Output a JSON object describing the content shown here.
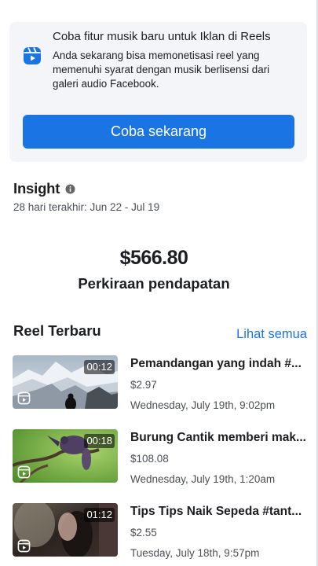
{
  "promo": {
    "title": "Coba fitur musik baru untuk Iklan di Reels",
    "description": "Anda sekarang bisa memonetisasi reel yang memenuhi syarat dengan musik berlisensi dari galeri audio Facebook.",
    "button_label": "Coba sekarang",
    "icon": "reels-icon"
  },
  "insight": {
    "title": "Insight",
    "range": "28 hari terakhir: Jun 22 - Jul 19",
    "icon": "info-icon"
  },
  "earnings": {
    "value": "$566.80",
    "label": "Perkiraan pendapatan"
  },
  "reels": {
    "title": "Reel Terbaru",
    "see_all": "Lihat semua",
    "items": [
      {
        "duration": "00:12",
        "title": "Pemandangan yang indah #...",
        "amount": "$2.97",
        "date": "Wednesday, July 19th, 9:02pm"
      },
      {
        "duration": "00:18",
        "title": "Burung Cantik memberi mak...",
        "amount": "$108.08",
        "date": "Wednesday, July 19th, 1:20am"
      },
      {
        "duration": "01:12",
        "title": "Tips Tips Naik Sepeda #tant...",
        "amount": "$2.55",
        "date": "Tuesday, July 18th, 9:57pm"
      }
    ]
  },
  "colors": {
    "accent": "#1b74e4",
    "card_bg": "#f3f5f8",
    "secondary_text": "#4b4f56"
  }
}
